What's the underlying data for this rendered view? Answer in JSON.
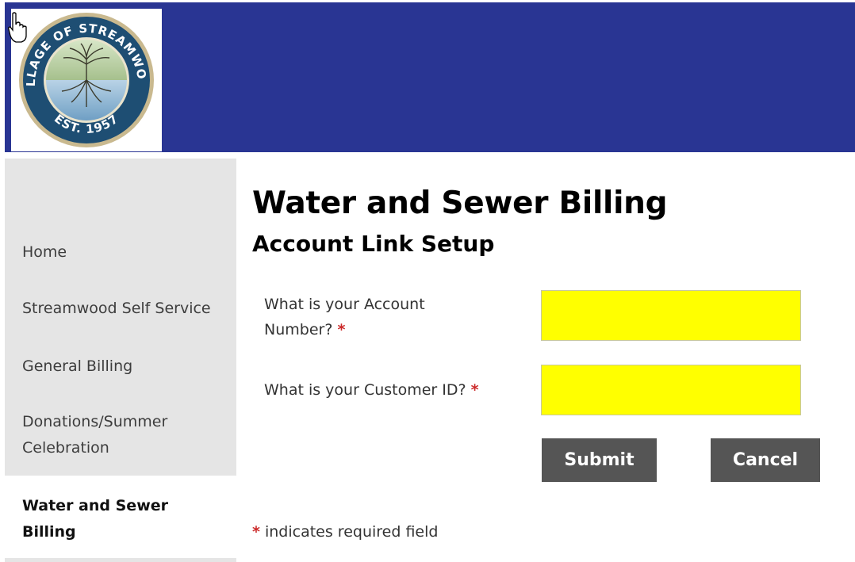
{
  "header": {
    "logo": {
      "top_text": "VILLAGE OF STREAMWOOD",
      "bottom_text": "EST. 1957",
      "icon": "tree-seal-logo"
    },
    "bg_color": "#293593"
  },
  "sidebar": {
    "items": [
      {
        "label": "Home"
      },
      {
        "label": "Streamwood Self Service"
      },
      {
        "label": "General Billing"
      },
      {
        "label": "Donations/Summer\nCelebration"
      }
    ],
    "active_item": {
      "label": "Water and Sewer\nBilling"
    }
  },
  "main": {
    "title": "Water and Sewer Billing",
    "subtitle": "Account Link Setup",
    "fields": [
      {
        "label": "What is your Account Number?",
        "required_marker": "*",
        "value": ""
      },
      {
        "label": "What is your Customer ID?",
        "required_marker": "*",
        "value": ""
      }
    ],
    "buttons": {
      "submit": "Submit",
      "cancel": "Cancel"
    },
    "required_note": {
      "marker": "*",
      "text": "indicates required field"
    }
  },
  "colors": {
    "header": "#293593",
    "input_bg": "#ffff00",
    "button_bg": "#555555",
    "required": "#cc2a2a"
  }
}
